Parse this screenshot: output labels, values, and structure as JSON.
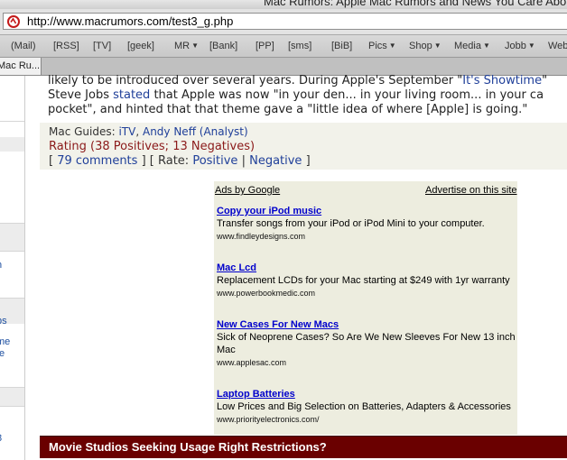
{
  "window": {
    "title": "Mac Rumors: Apple Mac Rumors and News You Care About"
  },
  "address_bar": {
    "url": "http://www.macrumors.com/test3_g.php"
  },
  "bookmarks": [
    "(Mail)",
    "[RSS]",
    "[TV]",
    "[geek]",
    "MR",
    "[Bank]",
    "[PP]",
    "[sms]",
    "[BiB]",
    "Pics",
    "Shop",
    "Media",
    "Jobb",
    "Web"
  ],
  "tab": {
    "label": "Mac Ru..."
  },
  "sidebar": {
    "fragments": [
      "n",
      "ps",
      "me",
      "te",
      "8"
    ]
  },
  "article": {
    "line1_text": "likely to be introduced over several years. During Apple's September \"",
    "line1_link": "It's Showtime",
    "line1_tail": "\" ",
    "line2_pre": "Steve Jobs ",
    "line2_link": "stated",
    "line2_post": " that Apple was now \"in your den... in your living room... in your ca",
    "line3": "pocket\", and hinted that that theme gave a \"little idea of where [Apple] is going.\""
  },
  "meta": {
    "guides_label": "Mac Guides: ",
    "guide1": "iTV",
    "guide_sep": ", ",
    "guide2": "Andy Neff (Analyst)",
    "rating": "Rating (38 Positives; 13 Negatives)",
    "comments_open": "[ ",
    "comments": "79 comments",
    "rate_mid": " ] [ Rate: ",
    "positive": "Positive",
    "rate_sep": " | ",
    "negative": "Negative",
    "rate_close": " ]"
  },
  "ads": {
    "ads_by_google": "Ads by Google",
    "advertise": "Advertise on this site",
    "items": [
      {
        "title": "Copy your iPod music",
        "desc": "Transfer songs from your iPod or iPod Mini to your computer.",
        "url": "www.findleydesigns.com"
      },
      {
        "title": "Mac Lcd",
        "desc": "Replacement LCDs for your Mac starting at $249 with 1yr warranty",
        "url": "www.powerbookmedic.com"
      },
      {
        "title": "New Cases For New Macs",
        "desc": "Sick of Neoprene Cases? So Are We New Sleeves For New 13 inch Mac",
        "url": "www.applesac.com"
      },
      {
        "title": "Laptop Batteries",
        "desc": "Low Prices and Big Selection on Batteries, Adapters & Accessories",
        "url": "www.priorityelectronics.com/"
      }
    ]
  },
  "next_headline": "Movie Studios Seeking Usage Right Restrictions?"
}
